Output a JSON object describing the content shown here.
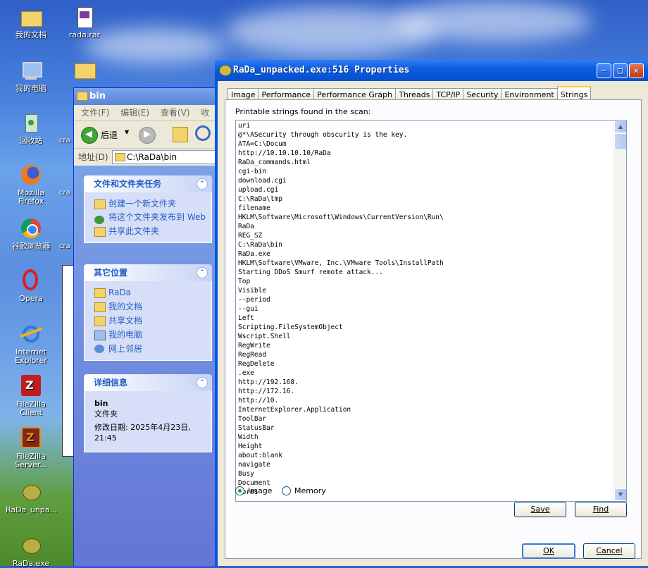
{
  "desktop": {
    "icons": [
      {
        "label": "我的文档"
      },
      {
        "label": "rada.rar"
      },
      {
        "label": "我的电脑"
      },
      {
        "label": "回收站"
      },
      {
        "label": "Mozilla Firefox"
      },
      {
        "label": "谷歌浏览器"
      },
      {
        "label": "Opera"
      },
      {
        "label": "Internet Explorer"
      },
      {
        "label": "FileZilla Client"
      },
      {
        "label": "FileZilla Server..."
      },
      {
        "label": "RaDa_unpa..."
      },
      {
        "label": "RaDa.exe"
      }
    ],
    "stubs": [
      "cra",
      "cra",
      "cra"
    ]
  },
  "explorer": {
    "title": "bin",
    "menu": [
      "文件(F)",
      "编辑(E)",
      "查看(V)",
      "收"
    ],
    "back_label": "后退",
    "address_label": "地址(D)",
    "address_value": "C:\\RaDa\\bin",
    "tasks": {
      "header": "文件和文件夹任务",
      "items": [
        "创建一个新文件夹",
        "将这个文件夹发布到 Web",
        "共享此文件夹"
      ]
    },
    "places": {
      "header": "其它位置",
      "items": [
        "RaDa",
        "我的文档",
        "共享文档",
        "我的电脑",
        "网上邻居"
      ]
    },
    "details": {
      "header": "详细信息",
      "name": "bin",
      "type": "文件夹",
      "modified": "修改日期: 2025年4月23日, 21:45"
    }
  },
  "dialog": {
    "title": "RaDa_unpacked.exe:516 Properties",
    "tabs": [
      "Image",
      "Performance",
      "Performance Graph",
      "Threads",
      "TCP/IP",
      "Security",
      "Environment",
      "Strings"
    ],
    "active_tab": "Strings",
    "caption": "Printable strings found in the scan:",
    "strings_text": "uri\n@*\\ASecurity through obscurity is the key.\nATA=C:\\Docum\nhttp://10.10.10.10/RaDa\nRaDa_commands.html\ncgi-bin\ndownload.cgi\nupload.cgi\nC:\\RaDa\\tmp\nfilename\nHKLM\\Software\\Microsoft\\Windows\\CurrentVersion\\Run\\\nRaDa\nREG_SZ\nC:\\RaDa\\bin\nRaDa.exe\nHKLM\\Software\\VMware, Inc.\\VMware Tools\\InstallPath\nStarting DDoS Smurf remote attack...\nTop\nVisible\n--period\n--gui\nLeft\nScripting.FileSystemObject\nWscript.Shell\nRegWrite\nRegRead\nRegDelete\n.exe\nhttp://192.168.\nhttp://172.16.\nhttp://10.\nInternetExplorer.Application\nToolBar\nStatusBar\nWidth\nHeight\nabout:blank\nnavigate\nBusy\nDocument\nForms",
    "radio_image": "Image",
    "radio_memory": "Memory",
    "selected_radio": "Image",
    "save_label": "Save",
    "find_label": "Find",
    "ok_label": "OK",
    "cancel_label": "Cancel"
  }
}
